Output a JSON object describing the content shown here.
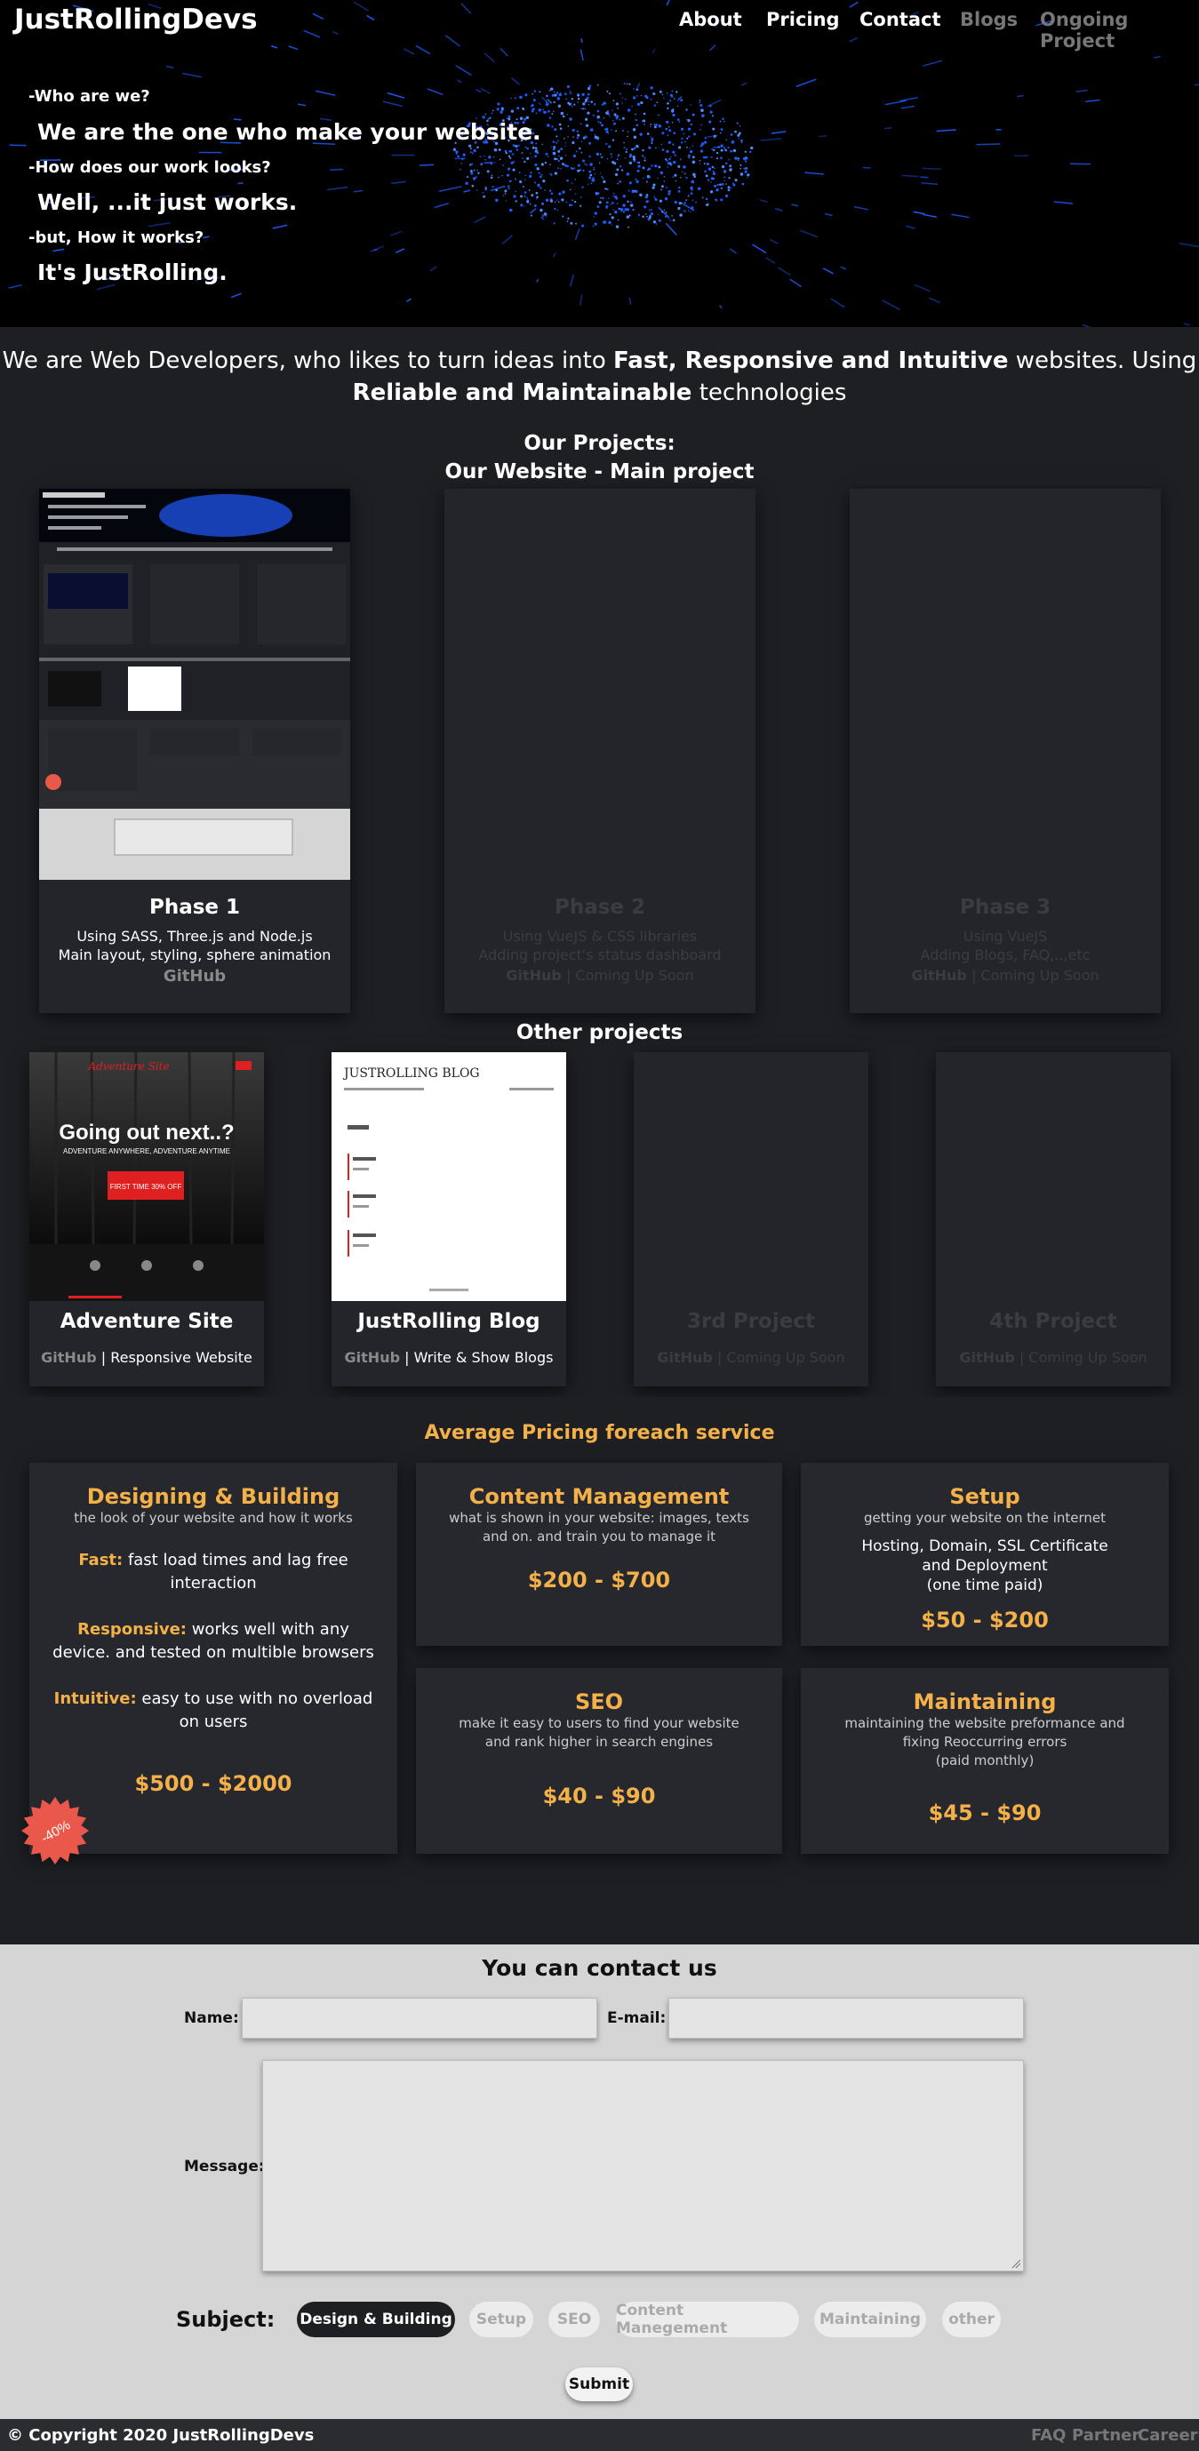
{
  "nav": {
    "logo": "JustRollingDevs",
    "links": [
      "About",
      "Pricing",
      "Contact",
      "Blogs",
      "Ongoing Project"
    ]
  },
  "hero": {
    "q1": "-Who are we?",
    "a1": "We are the one who make your website.",
    "q2": "-How does our work looks?",
    "a2": "Well, ...it just works.",
    "q3": "-but, How it works?",
    "a3": "It's JustRolling."
  },
  "intro": {
    "p1": "We are Web Developers, who likes to turn ideas into ",
    "s1": "Fast, Responsive and Intuitive",
    "p2": " websites. Using ",
    "s2": "Reliable and Maintainable",
    "p3": " technologies"
  },
  "projects": {
    "heading": "Our Projects:",
    "subheading": "Our Website - Main project",
    "phases": [
      {
        "title": "Phase 1",
        "line1": "Using SASS, Three.js and Node.js",
        "line2": "Main layout, styling, sphere animation",
        "github": "GitHub",
        "status": ""
      },
      {
        "title": "Phase 2",
        "line1": "Using VueJS & CSS libraries",
        "line2": "Adding project's status dashboard",
        "github": "GitHub",
        "status": "| Coming Up Soon"
      },
      {
        "title": "Phase 3",
        "line1": "Using VueJS",
        "line2": "Adding Blogs, FAQ,..,etc",
        "github": "GitHub",
        "status": "| Coming Up Soon"
      }
    ]
  },
  "other": {
    "heading": "Other projects",
    "items": [
      {
        "title": "Adventure Site",
        "github": "GitHub",
        "sep": " | ",
        "desc": "Responsive Website",
        "thumb_headline": "Going out next..?",
        "thumb_sub": "ADVENTURE ANYWHERE, ADVENTURE ANYTIME",
        "thumb_btn": "FIRST TIME 30% OFF",
        "thumb_logo": "Adventure Site"
      },
      {
        "title": "JustRolling Blog",
        "github": "GitHub",
        "sep": " | ",
        "desc": "Write & Show Blogs",
        "thumb_headline": "JUSTROLLING BLOG"
      },
      {
        "title": "3rd Project",
        "github": "GitHub",
        "sep": " | ",
        "desc": "Coming Up Soon"
      },
      {
        "title": "4th Project",
        "github": "GitHub",
        "sep": " | ",
        "desc": "Coming Up Soon"
      }
    ]
  },
  "pricing": {
    "heading": "Average Pricing foreach service",
    "design": {
      "title": "Designing & Building",
      "sub": "the look of your website and how it works",
      "f1k": "Fast:",
      "f1": " fast load times and lag free interaction",
      "f2k": "Responsive:",
      "f2": " works well with any device. and tested on multible browsers",
      "f3k": "Intuitive:",
      "f3": " easy to use with no overload on users",
      "price": "$500 - $2000",
      "badge": "-40%"
    },
    "content": {
      "title": "Content Management",
      "sub": "what is shown in your website: images, texts and on. and train you to manage it",
      "price": "$200 - $700"
    },
    "setup": {
      "title": "Setup",
      "sub": "getting your website on the internet",
      "body": "Hosting, Domain, SSL Certificate and Deployment",
      "note": "(one time paid)",
      "price": "$50 - $200"
    },
    "seo": {
      "title": "SEO",
      "sub": "make it easy to users to find your website and rank higher in search engines",
      "price": "$40 - $90"
    },
    "maint": {
      "title": "Maintaining",
      "sub": "maintaining the website preformance and fixing Reoccurring errors",
      "note": "(paid monthly)",
      "price": "$45 - $90"
    }
  },
  "contact": {
    "heading": "You can contact us",
    "name_label": "Name:",
    "email_label": "E-mail:",
    "message_label": "Message:",
    "subject_label": "Subject:",
    "subjects": [
      "Design & Building",
      "Setup",
      "SEO",
      "Content Manegement",
      "Maintaining",
      "other"
    ],
    "selected": "Design & Building",
    "submit": "Submit"
  },
  "footer": {
    "copyright": "© Copyright 2020 JustRollingDevs",
    "links": [
      "FAQ",
      "Partner",
      "Career"
    ]
  },
  "colors": {
    "accent": "#f5b149",
    "bg": "#1e1f23",
    "badge": "#e9584a",
    "sphere": "#1e5bff"
  }
}
